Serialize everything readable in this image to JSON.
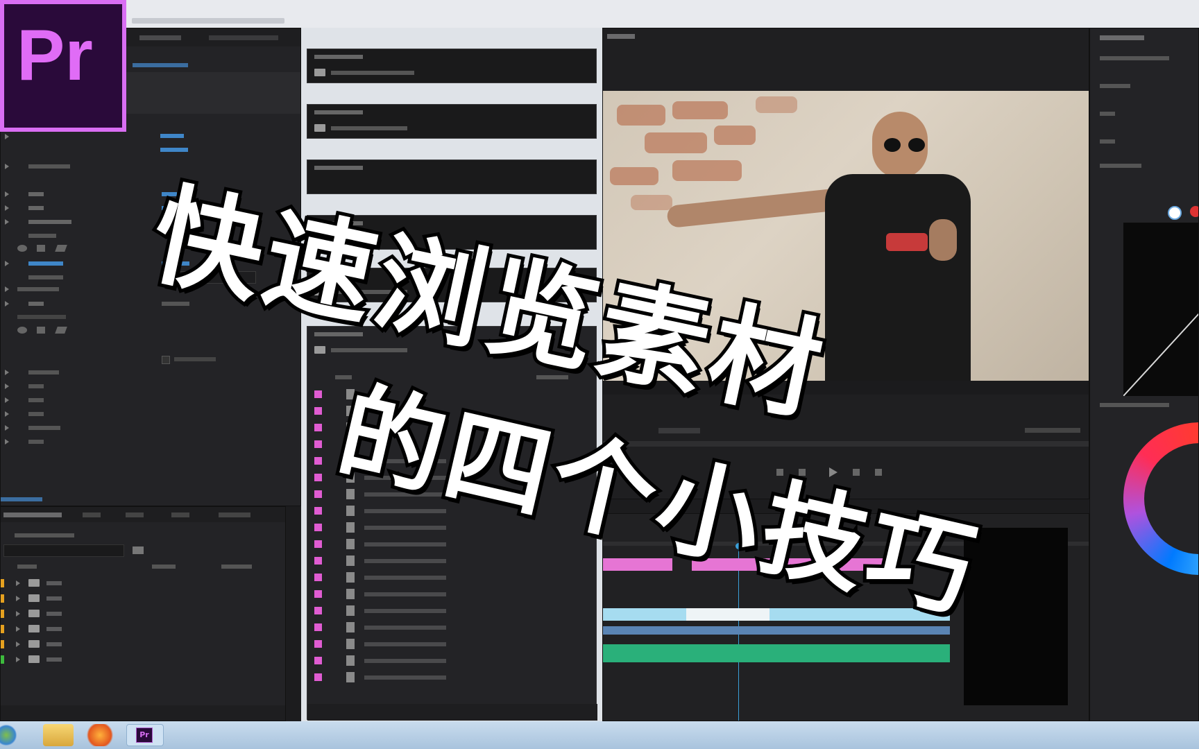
{
  "app": {
    "logo_text": "Pr",
    "logo_colors": {
      "bg": "#2a0a3a",
      "text": "#e06cf6",
      "border": "#d96ef3"
    }
  },
  "overlay_title": {
    "line1": "快速浏览素材",
    "line2": "的四个小技巧"
  },
  "menubar": {
    "items": [
      "",
      "",
      "",
      ""
    ]
  },
  "effects_panel": {
    "tabs": [
      "",
      ""
    ],
    "properties": [
      "",
      "",
      "",
      "",
      "",
      "",
      "",
      "",
      ""
    ],
    "lumetri_sections": [
      "",
      "",
      "",
      "",
      "",
      ""
    ]
  },
  "project_panel": {
    "tabs": [
      "",
      "",
      "",
      "",
      ""
    ],
    "columns": [
      "",
      "",
      ""
    ],
    "bins": [
      {
        "name": "",
        "color": "#e6a11f"
      },
      {
        "name": "",
        "color": "#e6a11f"
      },
      {
        "name": "",
        "color": "#e6a11f"
      },
      {
        "name": "",
        "color": "#e6a11f"
      },
      {
        "name": "",
        "color": "#e6a11f"
      },
      {
        "name": "",
        "color": "#3dbb3d"
      }
    ]
  },
  "bin_windows": {
    "count": 5,
    "file_rows": 18,
    "swatch_color": "#e05cd2"
  },
  "program_monitor": {
    "tab": "",
    "timecode": ""
  },
  "timeline": {
    "clip_colors": {
      "video_a": "#e675d4",
      "video_b": "#a6dcf0",
      "audio": "#2ab07a"
    }
  },
  "lumetri_panel": {
    "tab": "",
    "sections": [
      "",
      "",
      "",
      ""
    ]
  },
  "taskbar": {
    "buttons": [
      "start",
      "explorer",
      "firefox",
      "premiere"
    ],
    "premiere_label": "Pr"
  }
}
